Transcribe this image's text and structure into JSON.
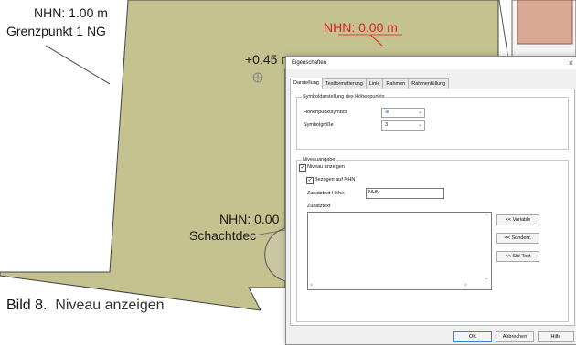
{
  "cad": {
    "label_nhn_left": "NHN: 1.00 m",
    "label_grenzpunkt": "Grenzpunkt 1 NG",
    "label_nhn_red": "NHN: 0.00 m",
    "label_plus": "+0.45 m",
    "label_nhn_bottom": "NHN: 0.00",
    "label_schacht": "Schachtdec",
    "colors": {
      "ground": "#c4c28f",
      "red_text": "#e0211b",
      "lines": "#505050"
    }
  },
  "dialog": {
    "title": "Eigenschaften",
    "close_icon": "close-icon",
    "tabs": [
      "Darstellung",
      "Textformatierung",
      "Linie",
      "Rahmen",
      "Rahmenfüllung"
    ],
    "active_tab": "Darstellung",
    "group_symbol": {
      "title": "Symboldarstellung des Höhenpunkts",
      "symbol_label": "Höhenpunktsymbol",
      "symbol_value": "⊕",
      "size_label": "Symbolgröße",
      "size_value": "3"
    },
    "group_niveau": {
      "title": "Niveauangabe",
      "show_level_label": "Niveau anzeigen",
      "show_level_checked": true,
      "ref_nhn_label": "Bezogen auf NHN",
      "ref_nhn_checked": true,
      "zusatz_hoehe_label": "Zusatztext Höhe:",
      "zusatz_hoehe_value": "NHN:",
      "zusatztext_label": "Zusatztext",
      "btn_variable": "<< Variable",
      "btn_sonderz": "<< Sonderz.",
      "btn_std_text": "<< Std-Text"
    },
    "footer": {
      "ok": "OK",
      "cancel": "Abbrechen",
      "help": "Hilfe"
    }
  },
  "caption": {
    "figure": "Bild 8.",
    "text": "Niveau anzeigen"
  }
}
